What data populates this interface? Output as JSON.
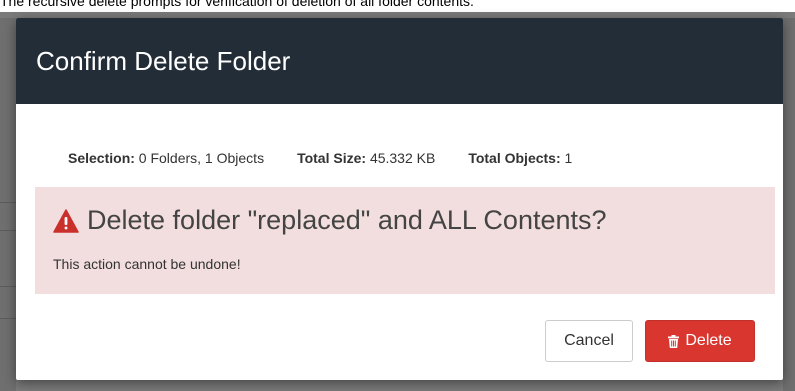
{
  "caption": "The recursive delete prompts for verification of deletion of all folder contents.",
  "dialog": {
    "title": "Confirm Delete Folder",
    "stats": {
      "selection_label": "Selection:",
      "selection_value": "0 Folders, 1 Objects",
      "size_label": "Total Size:",
      "size_value": "45.332 KB",
      "objects_label": "Total Objects:",
      "objects_value": "1"
    },
    "alert": {
      "heading": "Delete folder \"replaced\" and ALL Contents?",
      "subtext": "This action cannot be undone!",
      "icon": "warning-triangle-icon"
    },
    "buttons": {
      "cancel_label": "Cancel",
      "delete_label": "Delete",
      "delete_icon": "trash-icon"
    }
  },
  "colors": {
    "header_bg": "#222d38",
    "alert_bg": "#f2dede",
    "danger": "#d9362f",
    "warning_icon": "#c9302c"
  }
}
